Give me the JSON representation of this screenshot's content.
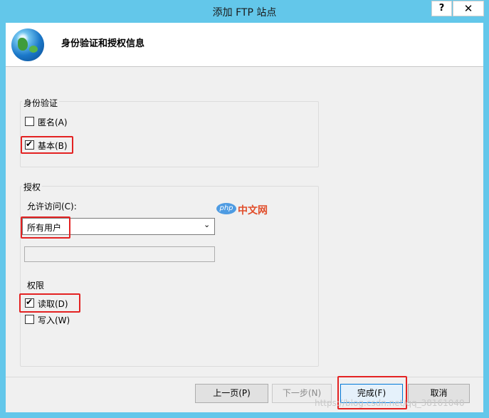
{
  "window": {
    "title": "添加 FTP 站点",
    "help": "?",
    "close": "✕"
  },
  "header": {
    "title": "身份验证和授权信息"
  },
  "authentication": {
    "group_title": "身份验证",
    "anonymous_label": "匿名(A)",
    "anonymous_checked": false,
    "basic_label": "基本(B)",
    "basic_checked": true
  },
  "authorization": {
    "group_title": "授权",
    "allow_access_label": "允许访问(C):",
    "allow_access_value": "所有用户",
    "textbox_value": "",
    "permissions_title": "权限",
    "read_label": "读取(D)",
    "read_checked": true,
    "write_label": "写入(W)",
    "write_checked": false
  },
  "watermark": {
    "badge": "php",
    "text": "中文网"
  },
  "buttons": {
    "prev": "上一页(P)",
    "next": "下一步(N)",
    "finish": "完成(F)",
    "cancel": "取消"
  },
  "footer_watermark": "https://blog.csdn.net/qq_38161040"
}
